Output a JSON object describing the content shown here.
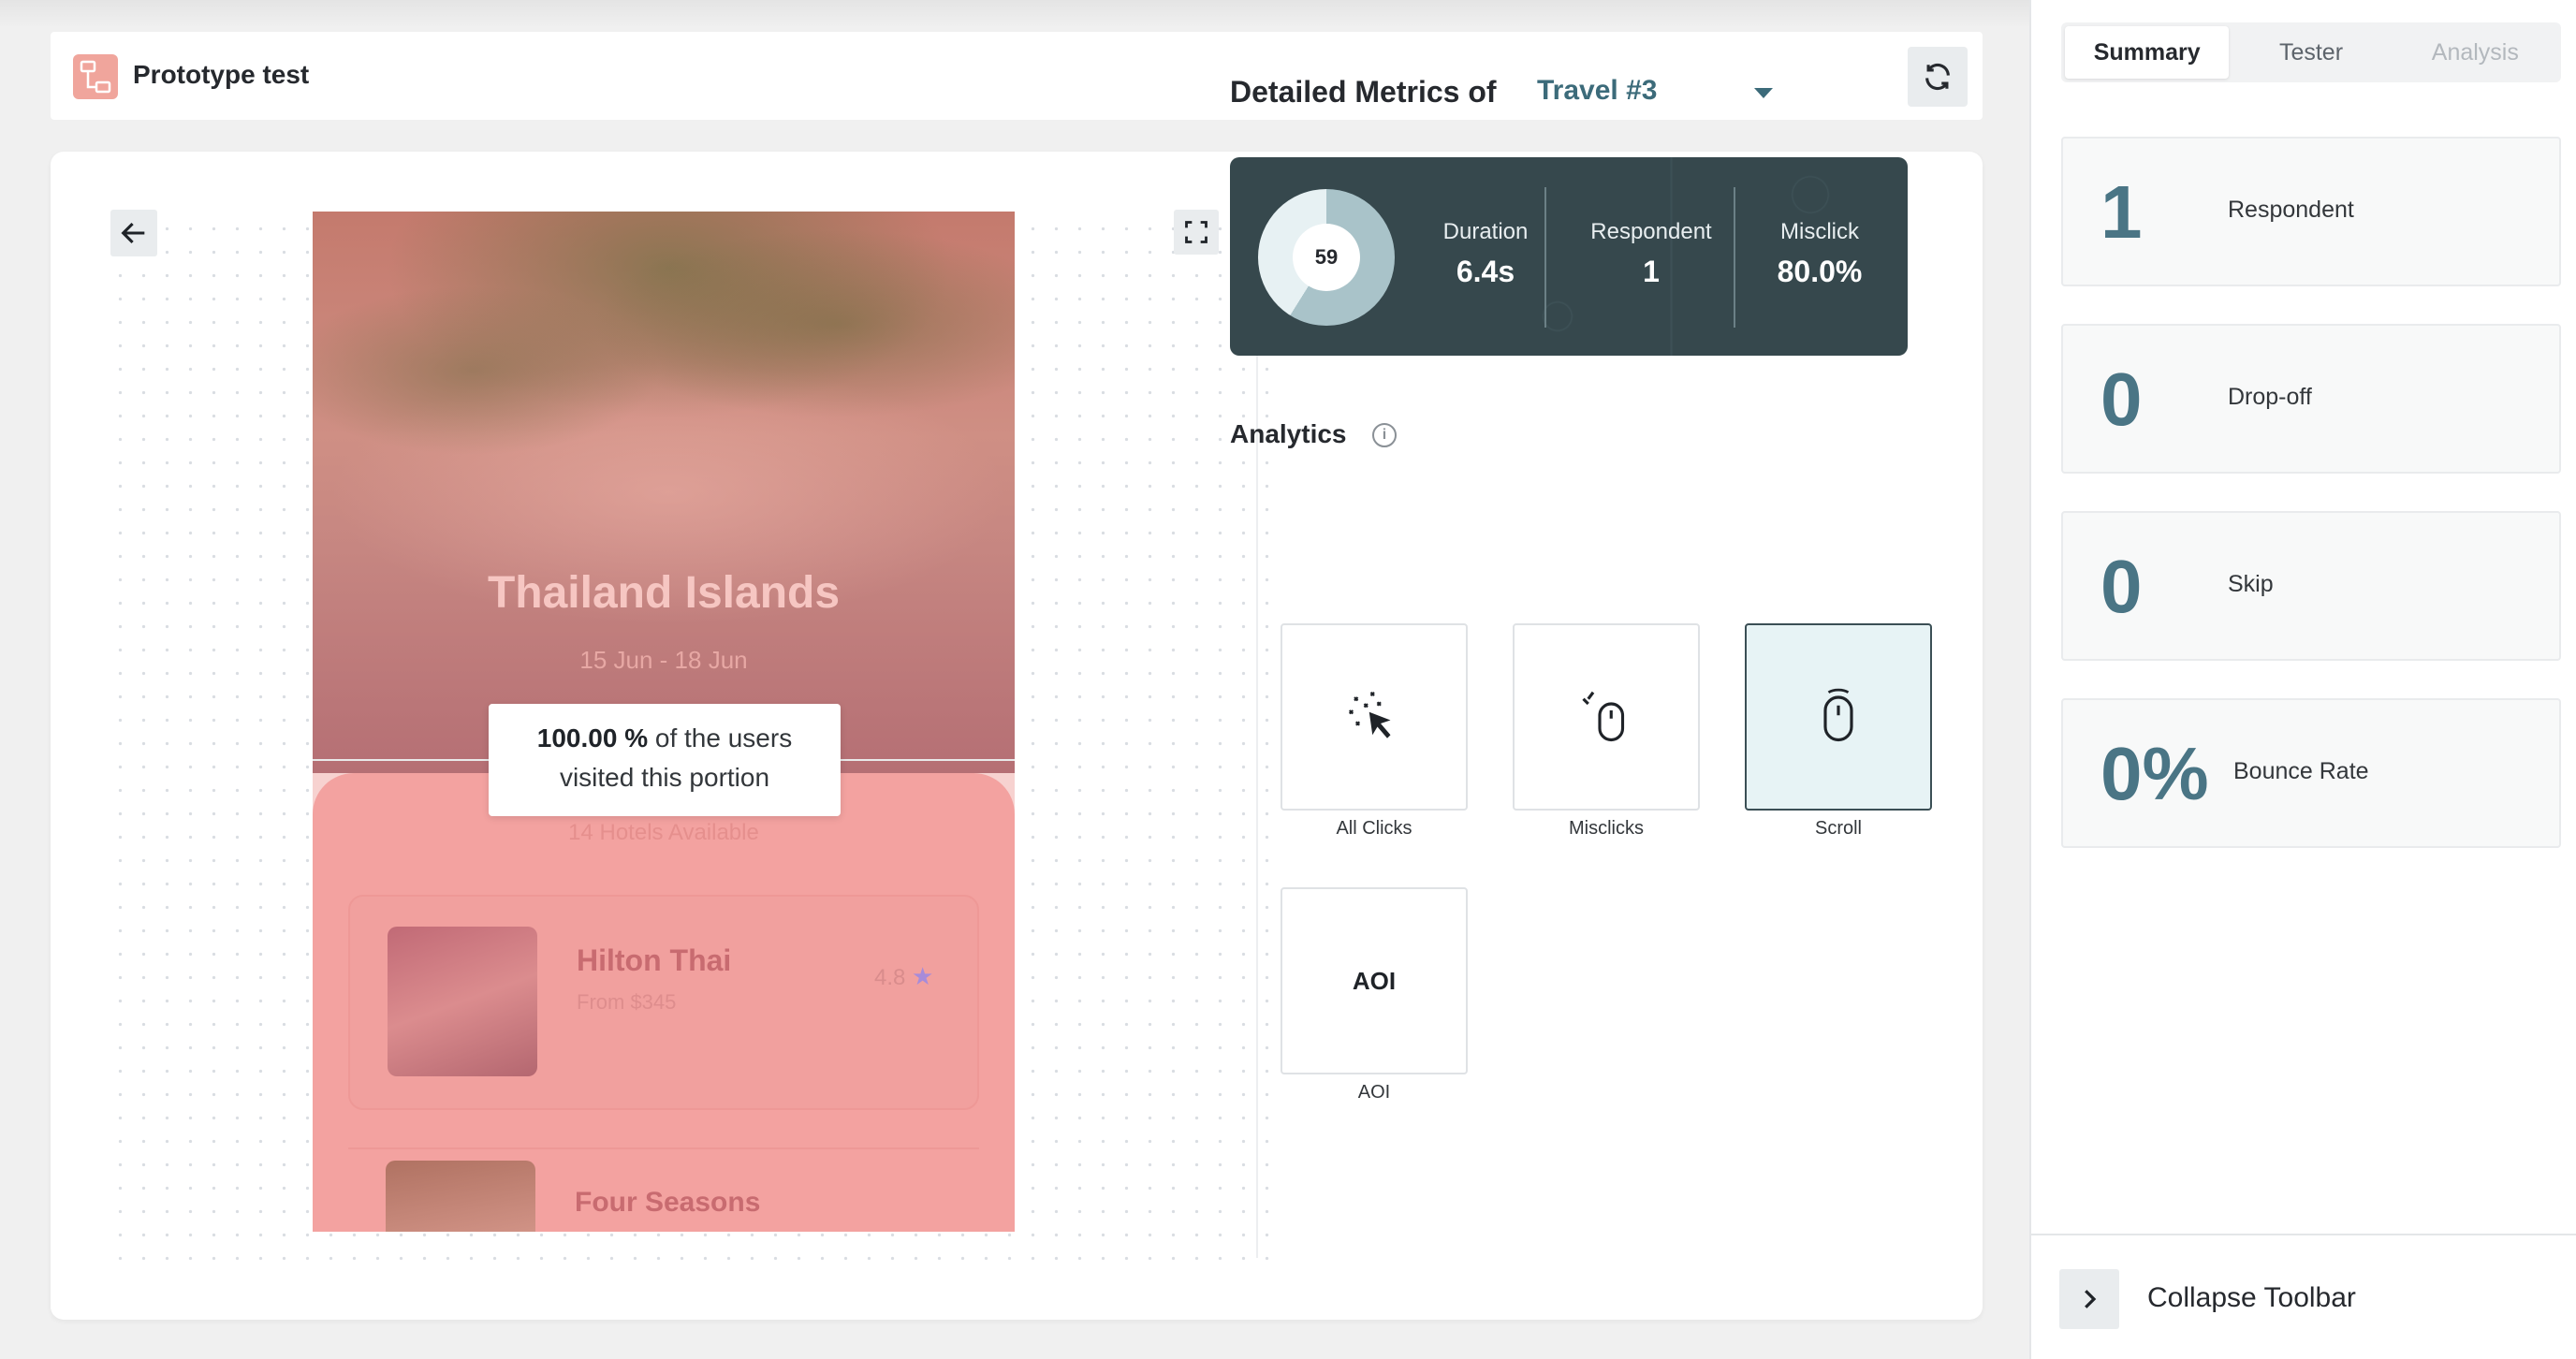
{
  "header": {
    "title": "Prototype test"
  },
  "prototype": {
    "screen_title": "Thailand Islands",
    "screen_dates": "15 Jun - 18 Jun",
    "hotels_available": "14 Hotels Available",
    "hotels": [
      {
        "name": "Hilton Thai",
        "price": "From $345",
        "rating": "4.8"
      },
      {
        "name": "Four Seasons"
      }
    ],
    "tooltip": {
      "percent": "100.00 %",
      "line1_rest": " of the users",
      "line2": "visited this portion"
    }
  },
  "metrics": {
    "title": "Detailed Metrics of",
    "selected": "Travel #3",
    "donut_value": "59",
    "donut_fraction": 0.59,
    "items": [
      {
        "label": "Duration",
        "value": "6.4s"
      },
      {
        "label": "Respondent",
        "value": "1"
      },
      {
        "label": "Misclick",
        "value": "80.0%"
      }
    ]
  },
  "analytics": {
    "title": "Analytics",
    "info_symbol": "i",
    "aoi_glyph": "AOI",
    "tiles": [
      {
        "label": "All Clicks",
        "selected": false
      },
      {
        "label": "Misclicks",
        "selected": false
      },
      {
        "label": "Scroll",
        "selected": true
      },
      {
        "label": "AOI",
        "selected": false
      }
    ]
  },
  "sidebar": {
    "tabs": [
      {
        "label": "Summary",
        "state": "active"
      },
      {
        "label": "Tester",
        "state": "normal"
      },
      {
        "label": "Analysis",
        "state": "disabled"
      }
    ],
    "stats": [
      {
        "value": "1",
        "label": "Respondent"
      },
      {
        "value": "0",
        "label": "Drop-off"
      },
      {
        "value": "0",
        "label": "Skip"
      },
      {
        "value": "0%",
        "label": "Bounce Rate"
      }
    ],
    "collapse_label": "Collapse Toolbar"
  },
  "colors": {
    "accent": "#4a7585",
    "panel_bg": "#36484d",
    "heatmap_overlay": "#f3a2a0",
    "prototype_icon": "#f0a59c"
  }
}
